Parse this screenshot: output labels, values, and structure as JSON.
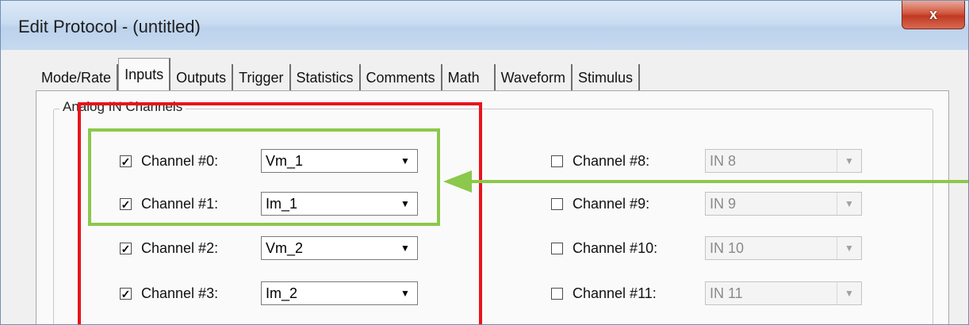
{
  "window": {
    "title": "Edit Protocol - (untitled)",
    "close_glyph": "x"
  },
  "tabs": [
    {
      "label": "Mode/Rate",
      "active": false
    },
    {
      "label": "Inputs",
      "active": true
    },
    {
      "label": "Outputs",
      "active": false
    },
    {
      "label": "Trigger",
      "active": false
    },
    {
      "label": "Statistics",
      "active": false
    },
    {
      "label": "Comments",
      "active": false
    },
    {
      "label": "Math",
      "active": false
    },
    {
      "label": "Waveform",
      "active": false
    },
    {
      "label": "Stimulus",
      "active": false
    }
  ],
  "group": {
    "label": "Analog IN Channels",
    "left_channels": [
      {
        "label": "Channel #0:",
        "checked": true,
        "value": "Vm_1"
      },
      {
        "label": "Channel #1:",
        "checked": true,
        "value": "Im_1"
      },
      {
        "label": "Channel #2:",
        "checked": true,
        "value": "Vm_2"
      },
      {
        "label": "Channel #3:",
        "checked": true,
        "value": "Im_2"
      }
    ],
    "right_channels": [
      {
        "label": "Channel #8:",
        "checked": false,
        "value": "IN 8"
      },
      {
        "label": "Channel #9:",
        "checked": false,
        "value": "IN 9"
      },
      {
        "label": "Channel #10:",
        "checked": false,
        "value": "IN 10"
      },
      {
        "label": "Channel #11:",
        "checked": false,
        "value": "IN 11"
      }
    ]
  },
  "glyphs": {
    "check": "✓",
    "dropdown": "▼"
  },
  "annotations": {
    "red_color": "#e8141b",
    "green_color": "#8cc84b"
  },
  "icons": [
    "close-icon",
    "checkbox-check-icon",
    "dropdown-arrow-icon",
    "annotation-arrow-icon"
  ]
}
